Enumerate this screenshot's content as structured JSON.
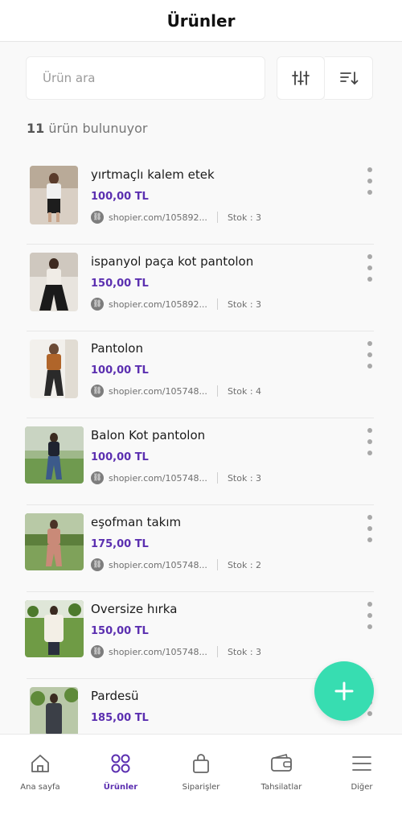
{
  "header": {
    "title": "Ürünler"
  },
  "search": {
    "placeholder": "Ürün ara"
  },
  "summary": {
    "count": "11",
    "text": " ürün bulunuyor"
  },
  "colors": {
    "accent": "#5b2fb0",
    "fab": "#37ddb1",
    "price": "#5b2fb0"
  },
  "products": [
    {
      "name": "yırtmaçlı kalem etek",
      "price": "100,00 TL",
      "link": "shopier.com/105892...",
      "stock": "Stok : 3"
    },
    {
      "name": "ispanyol paça kot pantolon",
      "price": "150,00 TL",
      "link": "shopier.com/105892...",
      "stock": "Stok : 3"
    },
    {
      "name": "Pantolon",
      "price": "100,00 TL",
      "link": "shopier.com/105748...",
      "stock": "Stok : 4"
    },
    {
      "name": "Balon Kot pantolon",
      "price": "100,00 TL",
      "link": "shopier.com/105748...",
      "stock": "Stok : 3"
    },
    {
      "name": "eşofman takım",
      "price": "175,00 TL",
      "link": "shopier.com/105748...",
      "stock": "Stok : 2"
    },
    {
      "name": "Oversize hırka",
      "price": "150,00 TL",
      "link": "shopier.com/105748...",
      "stock": "Stok : 3"
    },
    {
      "name": "Pardesü",
      "price": "185,00 TL",
      "link": "",
      "stock": ""
    }
  ],
  "tabs": [
    {
      "label": "Ana sayfa",
      "icon": "home-icon"
    },
    {
      "label": "Ürünler",
      "icon": "products-icon"
    },
    {
      "label": "Siparişler",
      "icon": "shopping-bag-icon"
    },
    {
      "label": "Tahsilatlar",
      "icon": "wallet-icon"
    },
    {
      "label": "Diğer",
      "icon": "menu-icon"
    }
  ]
}
